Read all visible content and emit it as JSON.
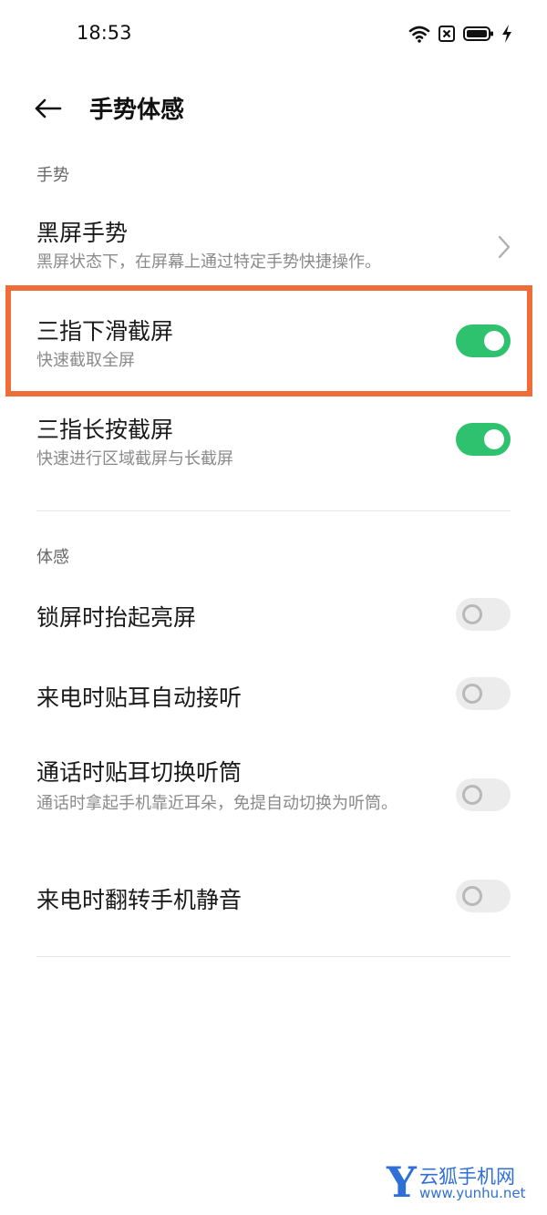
{
  "status_bar": {
    "time": "18:53",
    "icons": [
      "wifi-icon",
      "sim-off-icon",
      "battery-icon",
      "charging-bolt-icon"
    ]
  },
  "header": {
    "back_icon": "arrow-left-icon",
    "title": "手势体感"
  },
  "sections": {
    "gesture": {
      "label": "手势",
      "items": [
        {
          "title": "黑屏手势",
          "desc": "黑屏状态下，在屏幕上通过特定手势快捷操作。",
          "control": "chevron-right-icon"
        },
        {
          "title": "三指下滑截屏",
          "desc": "快速截取全屏",
          "toggle": true,
          "highlighted": true
        },
        {
          "title": "三指长按截屏",
          "desc": "快速进行区域截屏与长截屏",
          "toggle": true
        }
      ]
    },
    "motion": {
      "label": "体感",
      "items": [
        {
          "title": "锁屏时抬起亮屏",
          "toggle": false
        },
        {
          "title": "来电时贴耳自动接听",
          "toggle": false
        },
        {
          "title": "通话时贴耳切换听筒",
          "desc": "通话时拿起手机靠近耳朵，免提自动切换为听筒。",
          "toggle": false
        },
        {
          "title": "来电时翻转手机静音",
          "toggle": false
        }
      ]
    }
  },
  "colors": {
    "toggle_on": "#2fc26e",
    "toggle_off": "#ececec",
    "highlight": "#f06d3a",
    "watermark": "#2f6fd8"
  },
  "watermark": {
    "logo_letter": "Y",
    "name": "云狐手机网",
    "url": "www.yunhu.net"
  }
}
